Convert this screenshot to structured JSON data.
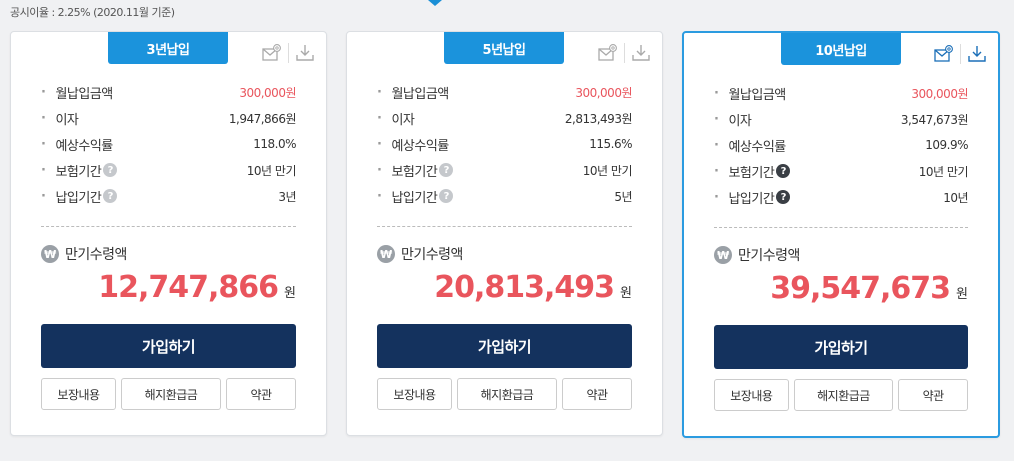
{
  "notice": "공시이율 : 2.25% (2020.11월 기준)",
  "colors": {
    "accent": "#1b93dc",
    "primary_button": "#14325e",
    "highlight_red": "#e9555d"
  },
  "cards": [
    {
      "tab": "3년납입",
      "rows": [
        {
          "label": "월납입금액",
          "value": "300,000원"
        },
        {
          "label": "이자",
          "value": "1,947,866원"
        },
        {
          "label": "예상수익률",
          "value": "118.0%"
        },
        {
          "label": "보험기간",
          "value": "10년 만기"
        },
        {
          "label": "납입기간",
          "value": "3년"
        }
      ],
      "maturity_label": "만기수령액",
      "maturity_amount": "12,747,866",
      "unit": "원",
      "join": "가입하기",
      "links": [
        "보장내용",
        "해지환급금",
        "약관"
      ]
    },
    {
      "tab": "5년납입",
      "rows": [
        {
          "label": "월납입금액",
          "value": "300,000원"
        },
        {
          "label": "이자",
          "value": "2,813,493원"
        },
        {
          "label": "예상수익률",
          "value": "115.6%"
        },
        {
          "label": "보험기간",
          "value": "10년 만기"
        },
        {
          "label": "납입기간",
          "value": "5년"
        }
      ],
      "maturity_label": "만기수령액",
      "maturity_amount": "20,813,493",
      "unit": "원",
      "join": "가입하기",
      "links": [
        "보장내용",
        "해지환급금",
        "약관"
      ]
    },
    {
      "tab": "10년납입",
      "rows": [
        {
          "label": "월납입금액",
          "value": "300,000원"
        },
        {
          "label": "이자",
          "value": "3,547,673원"
        },
        {
          "label": "예상수익률",
          "value": "109.9%"
        },
        {
          "label": "보험기간",
          "value": "10년 만기"
        },
        {
          "label": "납입기간",
          "value": "10년"
        }
      ],
      "maturity_label": "만기수령액",
      "maturity_amount": "39,547,673",
      "unit": "원",
      "join": "가입하기",
      "links": [
        "보장내용",
        "해지환급금",
        "약관"
      ]
    }
  ],
  "won_symbol": "₩",
  "help_symbol": "?",
  "icons": {
    "email": "email-icon",
    "download": "download-icon",
    "help": "help-icon",
    "won": "won-icon"
  }
}
